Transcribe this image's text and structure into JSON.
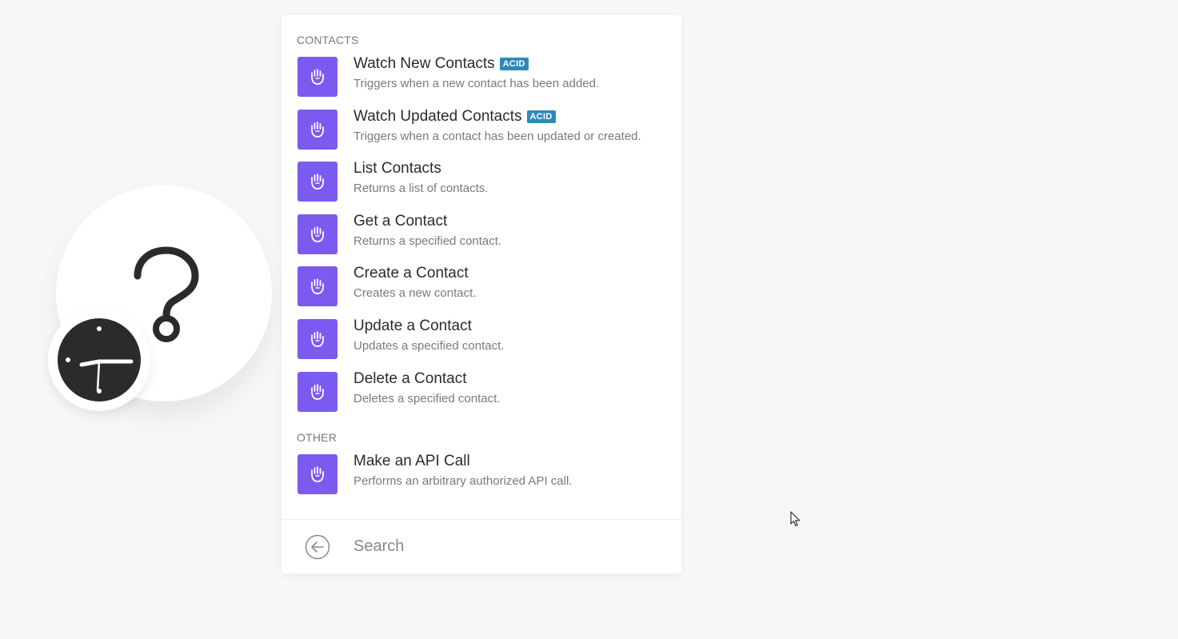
{
  "sections": [
    {
      "label": "CONTACTS",
      "items": [
        {
          "title": "Watch New Contacts",
          "badge": "ACID",
          "description": "Triggers when a new contact has been added."
        },
        {
          "title": "Watch Updated Contacts",
          "badge": "ACID",
          "description": "Triggers when a contact has been updated or created."
        },
        {
          "title": "List Contacts",
          "badge": "",
          "description": "Returns a list of contacts."
        },
        {
          "title": "Get a Contact",
          "badge": "",
          "description": "Returns a specified contact."
        },
        {
          "title": "Create a Contact",
          "badge": "",
          "description": "Creates a new contact."
        },
        {
          "title": "Update a Contact",
          "badge": "",
          "description": "Updates a specified contact."
        },
        {
          "title": "Delete a Contact",
          "badge": "",
          "description": "Deletes a specified contact."
        }
      ]
    },
    {
      "label": "OTHER",
      "items": [
        {
          "title": "Make an API Call",
          "badge": "",
          "description": "Performs an arbitrary authorized API call."
        }
      ]
    }
  ],
  "search": {
    "placeholder": "Search",
    "value": ""
  },
  "icons": {
    "module_icon": "hand-icon",
    "back": "arrow-left-circle-icon",
    "bubble_main": "question-mark-icon",
    "bubble_badge": "clock-icon"
  },
  "colors": {
    "module_icon_bg": "#7b5af0",
    "badge_bg": "#2d8ab8",
    "clock_bg": "#2b2b2b"
  }
}
